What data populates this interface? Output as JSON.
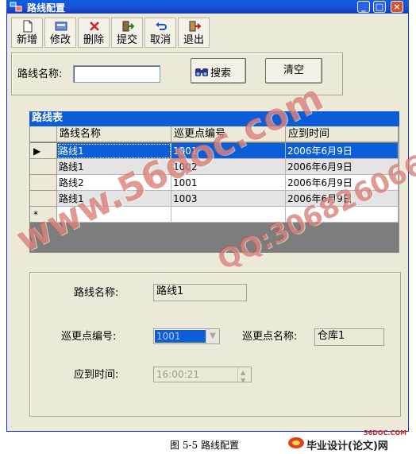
{
  "window": {
    "title": "路线配置"
  },
  "toolbar": [
    {
      "label": "新增",
      "icon": "new-document-icon"
    },
    {
      "label": "修改",
      "icon": "edit-icon"
    },
    {
      "label": "删除",
      "icon": "delete-icon"
    },
    {
      "label": "提交",
      "icon": "submit-icon"
    },
    {
      "label": "取消",
      "icon": "undo-icon"
    },
    {
      "label": "退出",
      "icon": "exit-icon"
    }
  ],
  "search": {
    "route_name_label": "路线名称:",
    "route_name_value": "",
    "search_button": "搜索",
    "clear_button": "清空"
  },
  "grid": {
    "caption": "路线表",
    "columns": [
      "路线名称",
      "巡更点编号",
      "应到时间"
    ],
    "rows": [
      [
        "路线1",
        "1001",
        "2006年6月9日"
      ],
      [
        "路线1",
        "1002",
        "2006年6月9日"
      ],
      [
        "路线2",
        "1001",
        "2006年6月9日"
      ],
      [
        "路线1",
        "1003",
        "2006年6月9日"
      ]
    ],
    "new_row_marker": "*",
    "current_row_marker": "▶"
  },
  "detail": {
    "route_name_label": "路线名称:",
    "route_name_value": "路线1",
    "point_no_label": "巡更点编号:",
    "point_no_value": "1001",
    "point_name_label": "巡更点名称:",
    "point_name_value": "仓库1",
    "time_label": "应到时间:",
    "time_value": "16:00:21"
  },
  "caption": "图 5-5  路线配置",
  "watermarks": {
    "site": "www.56doc.com",
    "qq": "QQ:306826066",
    "logo_small": "56DOC.COM",
    "logo_text": "毕业设计(论文)网"
  },
  "colors": {
    "titlebar": "#0a5fe0",
    "selection": "#0b5ed7",
    "window_bg": "#ece9d8"
  }
}
